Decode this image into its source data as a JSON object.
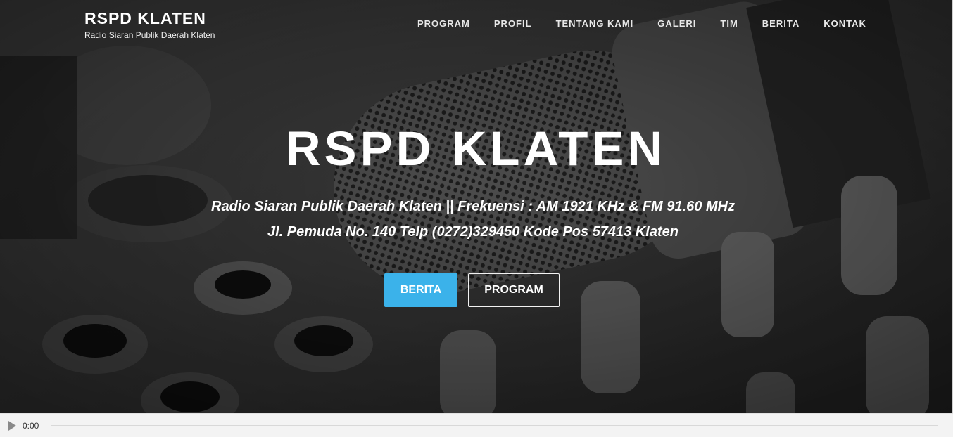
{
  "brand": {
    "title": "RSPD KLATEN",
    "subtitle": "Radio Siaran Publik Daerah Klaten"
  },
  "nav": {
    "items": [
      {
        "label": "PROGRAM"
      },
      {
        "label": "PROFIL"
      },
      {
        "label": "TENTANG KAMI"
      },
      {
        "label": "GALERI"
      },
      {
        "label": "TIM"
      },
      {
        "label": "BERITA"
      },
      {
        "label": "KONTAK"
      }
    ]
  },
  "hero": {
    "title": "RSPD KLATEN",
    "line1": "Radio Siaran Publik Daerah Klaten || Frekuensi : AM 1921 KHz & FM 91.60 MHz",
    "line2": "Jl. Pemuda No. 140 Telp (0272)329450 Kode Pos 57413 Klaten",
    "button_primary": "BERITA",
    "button_secondary": "PROGRAM",
    "accent_color": "#3bb2ea"
  },
  "player": {
    "time": "0:00",
    "play_icon": "play-icon",
    "progress": 0
  }
}
